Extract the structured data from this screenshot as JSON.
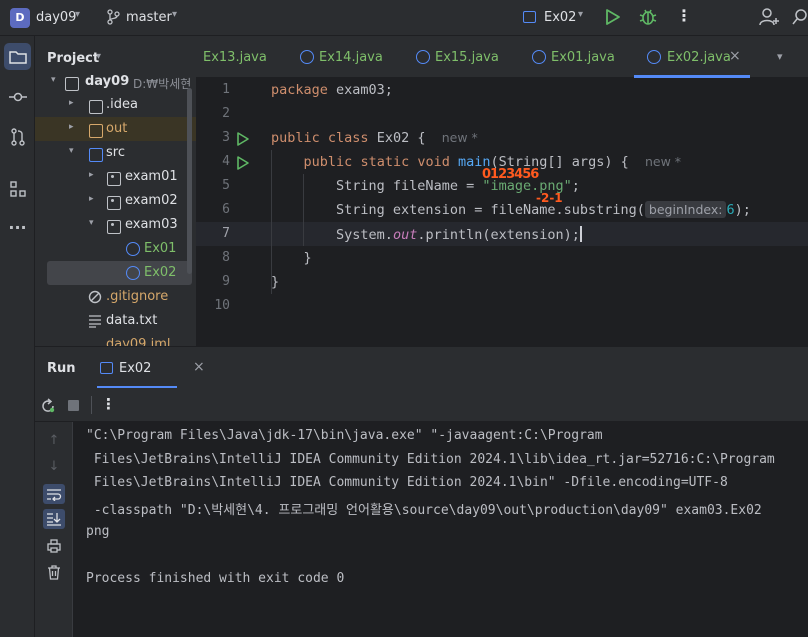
{
  "titlebar": {
    "project_badge": "D",
    "project_name": "day09",
    "branch": "master",
    "run_config": "Ex02"
  },
  "project_panel": {
    "title": "Project",
    "root": {
      "name": "day09",
      "path": "D:₩박세현"
    },
    "items": [
      {
        "name": ".idea",
        "type": "folder",
        "expanded": false
      },
      {
        "name": "out",
        "type": "folder-excluded",
        "expanded": false
      },
      {
        "name": "src",
        "type": "folder",
        "expanded": true
      },
      {
        "name": "exam01",
        "type": "package",
        "expanded": false
      },
      {
        "name": "exam02",
        "type": "package",
        "expanded": false
      },
      {
        "name": "exam03",
        "type": "package",
        "expanded": true
      },
      {
        "name": "Ex01",
        "type": "java-class"
      },
      {
        "name": "Ex02",
        "type": "java-class",
        "selected": true
      },
      {
        "name": ".gitignore",
        "type": "file"
      },
      {
        "name": "data.txt",
        "type": "file"
      },
      {
        "name": "day09.iml",
        "type": "file"
      }
    ]
  },
  "tabs": [
    {
      "label": "Ex13.java"
    },
    {
      "label": "Ex14.java"
    },
    {
      "label": "Ex15.java"
    },
    {
      "label": "Ex01.java"
    },
    {
      "label": "Ex02.java",
      "active": true
    }
  ],
  "editor": {
    "line_numbers": [
      "1",
      "2",
      "3",
      "4",
      "5",
      "6",
      "7",
      "8",
      "9",
      "10"
    ],
    "current_line": 7,
    "code": {
      "l1_kw": "package",
      "l1_rest": " exam03;",
      "l3_kw1": "public",
      "l3_kw2": "class",
      "l3_name": " Ex02 {",
      "l3_hint": "new *",
      "l4_kw1": "public",
      "l4_kw2": "static",
      "l4_kw3": "void",
      "l4_fn": "main",
      "l4_rest": "(String[] args) {",
      "l4_hint": "new *",
      "l5_a": "String fileName = ",
      "l5_str": "\"image.png\"",
      "l5_b": ";",
      "l6_a": "String extension = fileName.",
      "l6_fn": "substring",
      "l6_b": "(",
      "l6_param": "beginIndex:",
      "l6_num": "6",
      "l6_c": ");",
      "l7_a": "System.",
      "l7_fld": "out",
      "l7_b": ".println(extension);",
      "l8": "}",
      "l9": "}"
    },
    "annotation_top": "0123456",
    "annotation_bottom": "-2-1"
  },
  "run_panel": {
    "title": "Run",
    "tab": "Ex02",
    "console_lines": [
      "\"C:\\Program Files\\Java\\jdk-17\\bin\\java.exe\" \"-javaagent:C:\\Program",
      " Files\\JetBrains\\IntelliJ IDEA Community Edition 2024.1\\lib\\idea_rt.jar=52716:C:\\Program",
      " Files\\JetBrains\\IntelliJ IDEA Community Edition 2024.1\\bin\" -Dfile.encoding=UTF-8",
      " -classpath \"D:\\박세현\\4. 프로그래밍 언어활용\\source\\day09\\out\\production\\day09\" exam03.Ex02",
      "png",
      "",
      "Process finished with exit code 0"
    ]
  },
  "colors": {
    "accent": "#548af7",
    "run_green": "#5fb865",
    "keyword": "#cf8e6d",
    "string": "#6aab73",
    "annotation": "#ff5a1f"
  }
}
